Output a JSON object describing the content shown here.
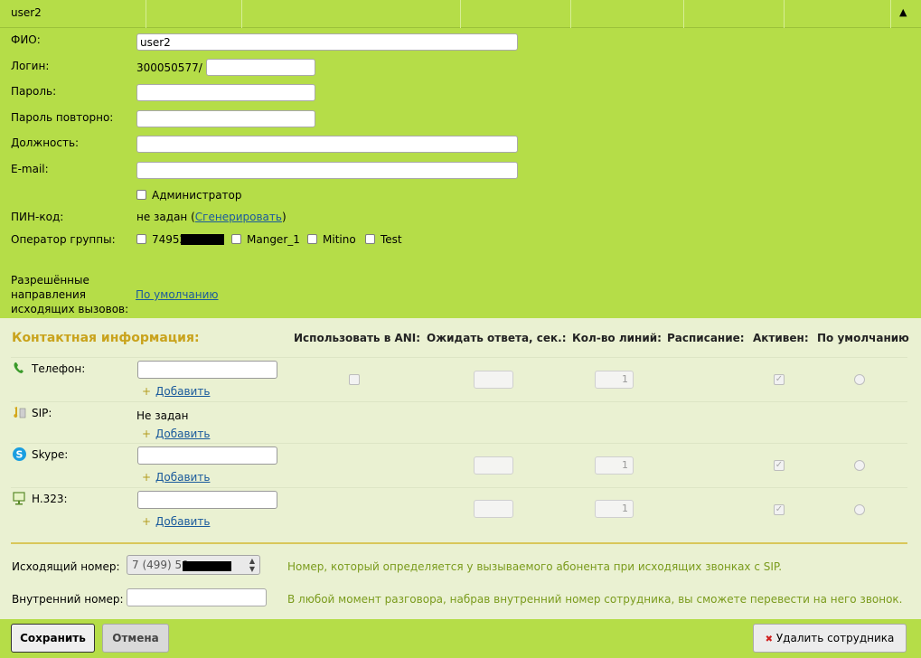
{
  "header": {
    "title": "user2",
    "collapse_icon": "▲"
  },
  "form": {
    "fio_label": "ФИО:",
    "fio_value": "user2",
    "login_label": "Логин:",
    "login_prefix": "300050577/",
    "password_label": "Пароль:",
    "password_repeat_label": "Пароль повторно:",
    "position_label": "Должность:",
    "email_label": "E-mail:",
    "admin_label": "Администратор",
    "pin_label": "ПИН-код:",
    "pin_status": "не задан (",
    "pin_generate": "Сгенерировать",
    "pin_close": ")",
    "group_operator_label": "Оператор группы:",
    "groups": [
      "74952",
      "Manger_1",
      "Mitino",
      "Test"
    ],
    "allowed_dirs_label_1": "Разрешённые",
    "allowed_dirs_label_2": "направления",
    "allowed_dirs_label_3": "исходящих вызовов:",
    "allowed_dirs_link": "По умолчанию"
  },
  "contact": {
    "title": "Контактная информация:",
    "columns": [
      "Использовать в ANI:",
      "Ожидать ответа, сек.:",
      "Кол-во линий:",
      "Расписание:",
      "Активен:",
      "По умолчанию"
    ],
    "rows": [
      {
        "label": "Телефон:",
        "icon": "phone-icon",
        "lines": "1"
      },
      {
        "label": "SIP:",
        "icon": "sip-icon",
        "status": "Не задан"
      },
      {
        "label": "Skype:",
        "icon": "skype-icon",
        "lines": "1"
      },
      {
        "label": "H.323:",
        "icon": "h323-icon",
        "lines": "1"
      }
    ],
    "add_plus": "+",
    "add_label": "Добавить",
    "outgoing_label": "Исходящий номер:",
    "outgoing_value": "7 (499) 50",
    "outgoing_hint": "Номер, который определяется у вызываемого абонента при исходящих звонках с SIP.",
    "internal_label": "Внутренний номер:",
    "internal_hint": "В любой момент разговора, набрав внутренний номер сотрудника, вы сможете перевести на него звонок."
  },
  "footer": {
    "save": "Сохранить",
    "cancel": "Отмена",
    "delete_icon": "✖",
    "delete": "Удалить сотрудника"
  },
  "colors": {
    "green_bg": "#b5dd48",
    "section_bg": "#eaf1d2",
    "section_title": "#c9a31c",
    "hint": "#7a9b1c",
    "link": "#1a5a9c"
  }
}
